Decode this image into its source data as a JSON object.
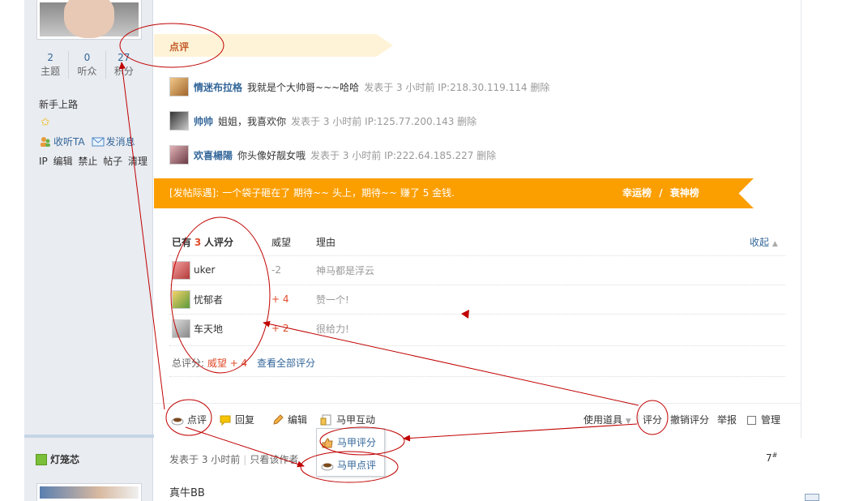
{
  "user": {
    "stats": [
      {
        "value": "2",
        "label": "主题"
      },
      {
        "value": "0",
        "label": "听众"
      },
      {
        "value": "27",
        "label": "积分"
      }
    ],
    "rank": "新手上路",
    "follow_label": "收听TA",
    "message_label": "发消息",
    "admin_links": "IP 编辑 禁止 帖子 清理"
  },
  "review": {
    "title": "点评",
    "comments": [
      {
        "name": "情迷布拉格",
        "text": "我就是个大帅哥~~~哈哈",
        "meta": "发表于 3 小时前 IP:218.30.119.114 删除"
      },
      {
        "name": "帅帅",
        "text": "姐姐，我喜欢你",
        "meta": "发表于 3 小时前 IP:125.77.200.143 删除"
      },
      {
        "name": "欢喜楊陽",
        "text": "你头像好靓女哦",
        "meta": "发表于 3 小时前 IP:222.64.185.227 删除"
      }
    ]
  },
  "banner": {
    "text": "[发帖际遇]: 一个袋子砸在了 期待~~ 头上，期待~~ 赚了 5 金钱.",
    "lucky": "幸运榜",
    "sep": "/",
    "unlucky": "衰神榜"
  },
  "rating": {
    "head_prefix": "已有",
    "head_count": "3",
    "head_suffix": "人评分",
    "col_score": "威望",
    "col_reason": "理由",
    "collapse": "收起",
    "rows": [
      {
        "name": "uker",
        "score": "-2",
        "reason": "神马都是浮云"
      },
      {
        "name": "忧郁者",
        "score": "+ 4",
        "reason": "赞一个!"
      },
      {
        "name": "车天地",
        "score": "+ 2",
        "reason": "很给力!"
      }
    ],
    "total_label": "总评分:",
    "total_value": "威望 + 4",
    "view_all": "查看全部评分"
  },
  "actions": {
    "review": "点评",
    "reply": "回复",
    "edit": "编辑",
    "vest_interact": "马甲互动",
    "use_tool": "使用道具",
    "rate": "评分",
    "undo_rate": "撤销评分",
    "report": "举报",
    "manage": "管理"
  },
  "dropdown": {
    "vest_rate": "马甲评分",
    "vest_review": "马甲点评"
  },
  "post2": {
    "author": "灯笼芯",
    "time": "发表于 3 小时前",
    "only_author": "只看该作者",
    "floor": "7",
    "floor_sup": "#",
    "body": "真牛BB"
  },
  "colors": {
    "accent_orange": "#fb9e00",
    "link_blue": "#336699",
    "annotation_red": "#c00000"
  }
}
